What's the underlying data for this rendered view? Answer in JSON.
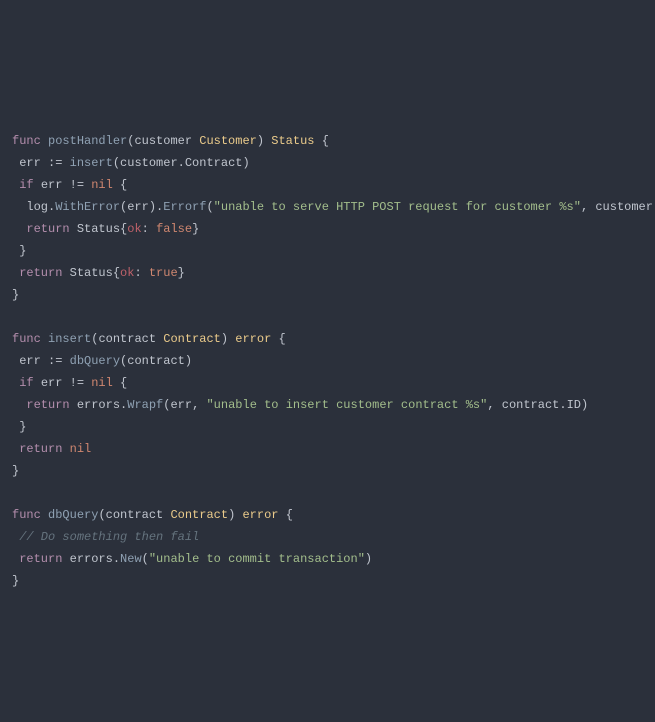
{
  "code": {
    "kw_func": "func",
    "kw_if": "if",
    "kw_return": "return",
    "fn_postHandler": "postHandler",
    "fn_insert": "insert",
    "fn_dbQuery": "dbQuery",
    "type_Customer": "Customer",
    "type_Status": "Status",
    "type_Contract": "Contract",
    "type_error": "error",
    "id_customer": "customer",
    "id_contract": "contract",
    "id_err": "err",
    "id_log": "log",
    "id_errors": "errors",
    "id_nil": "nil",
    "id_true": "true",
    "id_false": "false",
    "call_insert": "insert",
    "call_dbQuery": "dbQuery",
    "call_WithError": "WithError",
    "call_Errorf": "Errorf",
    "call_Wrapf": "Wrapf",
    "call_New": "New",
    "field_Contract": "Contract",
    "field_ID": "ID",
    "field_ok": "ok",
    "str_httpPost": "\"unable to serve HTTP POST request for customer %s\"",
    "str_insert": "\"unable to insert customer contract %s\"",
    "str_commit": "\"unable to commit transaction\"",
    "cmt_fail": "// Do something then fail",
    "p_lparen": "(",
    "p_rparen": ")",
    "p_lbrace": "{",
    "p_rbrace": "}",
    "p_dot": ".",
    "p_comma": ", ",
    "p_colon": ": ",
    "p_assign": " := ",
    "p_ne": " != "
  }
}
